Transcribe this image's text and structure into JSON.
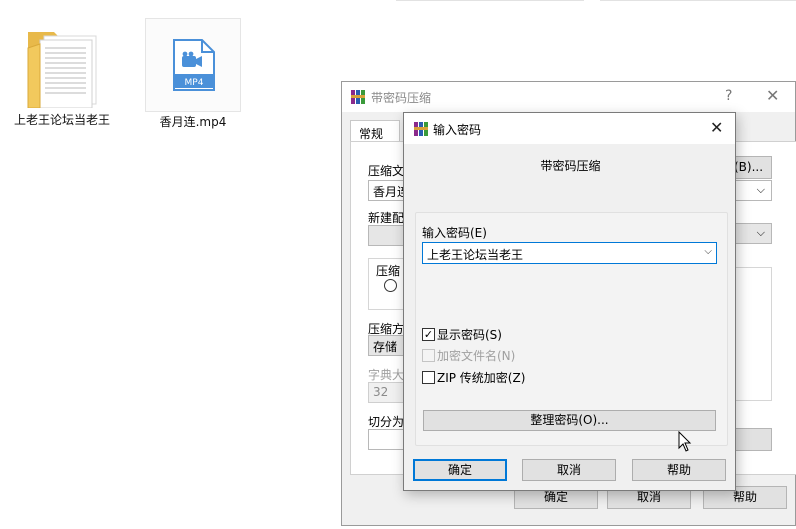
{
  "desktop": {
    "folder": {
      "label": "上老王论坛当老王"
    },
    "video": {
      "label": "香月连.mp4",
      "badge": "MP4"
    }
  },
  "background_dialog": {
    "title": "带密码压缩",
    "help": "?",
    "tab": "常规",
    "archive_label": "压缩文",
    "browse_button": "(B)...",
    "archive_value": "香月连",
    "new_label": "新建配",
    "group_label": "压缩",
    "method_label": "压缩方",
    "method_value": "存储",
    "dict_label": "字典大",
    "dict_value": "32",
    "split_label": "切分为",
    "ok": "确定",
    "cancel": "取消",
    "help_button": "帮助"
  },
  "password_dialog": {
    "title": "输入密码",
    "heading": "带密码压缩",
    "password_label": "输入密码(E)",
    "password_value": "上老王论坛当老王",
    "show_password": {
      "label": "显示密码(S)",
      "checked": true
    },
    "encrypt_names": {
      "label": "加密文件名(N)",
      "checked": false,
      "disabled": true
    },
    "zip_legacy": {
      "label": "ZIP 传统加密(Z)",
      "checked": false
    },
    "organize_button": "整理密码(O)...",
    "ok": "确定",
    "cancel": "取消",
    "help": "帮助"
  }
}
